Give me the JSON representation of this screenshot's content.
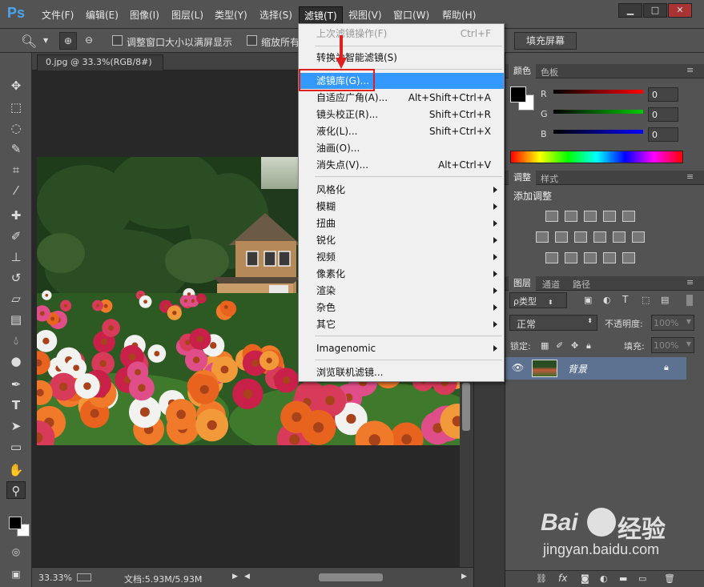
{
  "app": {
    "logo": "Ps"
  },
  "menubar": {
    "items": [
      "文件(F)",
      "编辑(E)",
      "图像(I)",
      "图层(L)",
      "类型(Y)",
      "选择(S)",
      "滤镜(T)",
      "视图(V)",
      "窗口(W)",
      "帮助(H)"
    ],
    "window_buttons": [
      "▁",
      "□",
      "✕"
    ]
  },
  "options": {
    "check1": "调整窗口大小以满屏显示",
    "check2": "缩放所有",
    "button_fill": "填充屏幕"
  },
  "document": {
    "tab_title": "0.jpg @ 33.3%(RGB/8#)",
    "tab_close": "×",
    "zoom": "33.33%",
    "doc_info": "文档:5.93M/5.93M"
  },
  "filter_menu": {
    "last": {
      "label": "上次滤镜操作(F)",
      "shortcut": "Ctrl+F"
    },
    "smart": "转换为智能滤镜(S)",
    "group1": [
      {
        "label": "滤镜库(G)...",
        "shortcut": ""
      },
      {
        "label": "自适应广角(A)...",
        "shortcut": "Alt+Shift+Ctrl+A"
      },
      {
        "label": "镜头校正(R)...",
        "shortcut": "Shift+Ctrl+R"
      },
      {
        "label": "液化(L)...",
        "shortcut": "Shift+Ctrl+X"
      },
      {
        "label": "油画(O)...",
        "shortcut": ""
      },
      {
        "label": "消失点(V)...",
        "shortcut": "Alt+Ctrl+V"
      }
    ],
    "submenus": [
      "风格化",
      "模糊",
      "扭曲",
      "锐化",
      "视频",
      "像素化",
      "渲染",
      "杂色",
      "其它"
    ],
    "plugin": "Imagenomic",
    "browse": "浏览联机滤镜..."
  },
  "color_panel": {
    "tabs": [
      "颜色",
      "色板"
    ],
    "channels": [
      {
        "name": "R",
        "value": "0"
      },
      {
        "name": "G",
        "value": "0"
      },
      {
        "name": "B",
        "value": "0"
      }
    ]
  },
  "adjust_panel": {
    "tabs": [
      "调整",
      "样式"
    ],
    "title": "添加调整"
  },
  "layers_panel": {
    "tabs": [
      "图层",
      "通道",
      "路径"
    ],
    "filter_kind": "ρ类型",
    "blend_mode": "正常",
    "opacity_label": "不透明度:",
    "opacity_value": "100%",
    "lock_label": "锁定:",
    "fill_label": "填充:",
    "fill_value": "100%",
    "layer_name": "背景"
  },
  "watermark": {
    "brand": "Bai",
    "brand2": "经验",
    "url": "jingyan.baidu.com"
  }
}
